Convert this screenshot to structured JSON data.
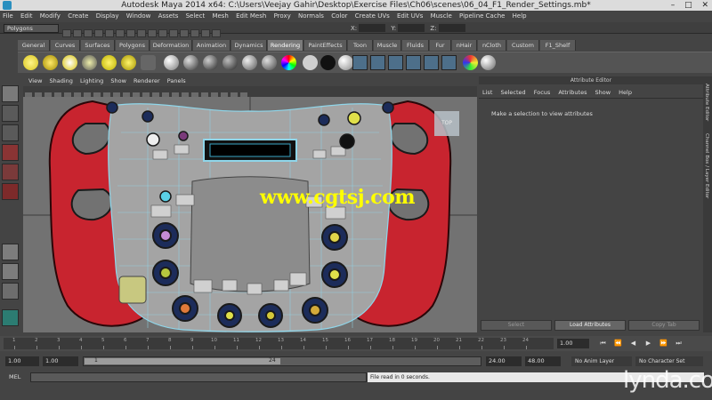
{
  "window": {
    "title": "Autodesk Maya 2014 x64: C:\\Users\\Veejay Gahir\\Desktop\\Exercise Files\\Ch06\\scenes\\06_04_F1_Render_Settings.mb*",
    "controls": [
      "–",
      "□",
      "✕"
    ]
  },
  "menubar": [
    "File",
    "Edit",
    "Modify",
    "Create",
    "Display",
    "Window",
    "Assets",
    "Select",
    "Mesh",
    "Edit Mesh",
    "Proxy",
    "Normals",
    "Color",
    "Create UVs",
    "Edit UVs",
    "Muscle",
    "Pipeline Cache",
    "Help"
  ],
  "statusline": {
    "mode": "Polygons",
    "xyz": [
      "X:",
      "Y:",
      "Z:"
    ]
  },
  "shelf_tabs": [
    "General",
    "Curves",
    "Surfaces",
    "Polygons",
    "Deformation",
    "Animation",
    "Dynamics",
    "Rendering",
    "PaintEffects",
    "Toon",
    "Muscle",
    "Fluids",
    "Fur",
    "nHair",
    "nCloth",
    "Custom",
    "F1_Shelf"
  ],
  "active_shelf_tab": "Rendering",
  "panel_menu": [
    "View",
    "Shading",
    "Lighting",
    "Show",
    "Renderer",
    "Panels"
  ],
  "viewport": {
    "view_cube_label": "TOP",
    "watermark": "www.cgtsj.com"
  },
  "attribute_editor": {
    "header": "Attribute Editor",
    "menu": [
      "List",
      "Selected",
      "Focus",
      "Attributes",
      "Show",
      "Help"
    ],
    "message": "Make a selection to view attributes",
    "buttons": [
      "Select",
      "Load Attributes",
      "Copy Tab"
    ]
  },
  "side_tabs": [
    "Attribute Editor",
    "Channel Box / Layer Editor"
  ],
  "time_slider": {
    "ticks": [
      "1",
      "2",
      "3",
      "4",
      "5",
      "6",
      "7",
      "8",
      "9",
      "10",
      "11",
      "12",
      "13",
      "14",
      "15",
      "16",
      "17",
      "18",
      "19",
      "20",
      "21",
      "22",
      "23",
      "24"
    ],
    "current_frame": "1.00",
    "playback": [
      "⏮",
      "⏪",
      "◀",
      "▶",
      "⏩",
      "⏭"
    ]
  },
  "range_slider": {
    "start_time": "1.00",
    "playback_start": "1.00",
    "range_start_label": "1",
    "range_end_label": "24",
    "playback_end": "24.00",
    "end_time": "48.00",
    "anim_layer": "No Anim Layer",
    "character_set": "No Character Set"
  },
  "command_line": {
    "label": "MEL",
    "result": "File read in 0 seconds."
  },
  "branding": "lynda.com",
  "colors": {
    "rim_red": "#c8242f",
    "wireframe": "#8fd6ea",
    "active_tab": "#7a7a7a",
    "watermark": "#ffff00"
  }
}
